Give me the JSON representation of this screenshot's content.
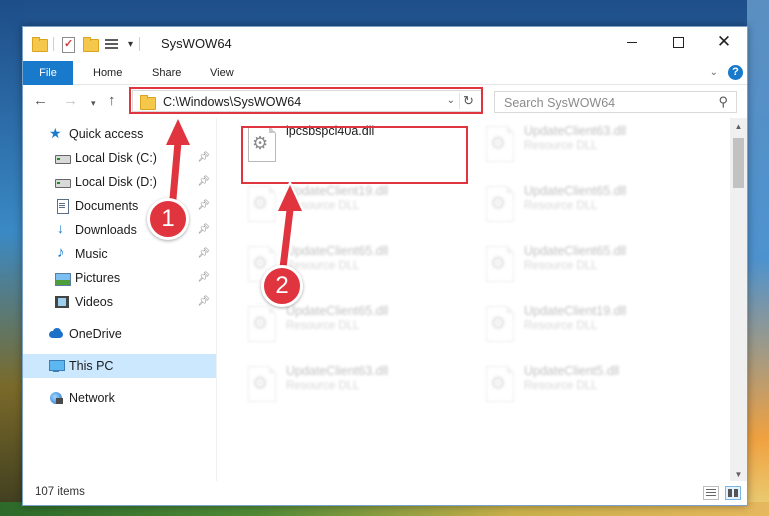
{
  "window": {
    "title": "SysWOW64",
    "controls": {
      "minimize": "",
      "maximize": "",
      "close": "✕"
    }
  },
  "ribbon": {
    "tabs": [
      "File",
      "Home",
      "Share",
      "View"
    ],
    "help": "?"
  },
  "address": {
    "path": "C:\\Windows\\SysWOW64",
    "refresh_icon": "↻",
    "dropdown_icon": "⌄"
  },
  "search": {
    "placeholder": "Search SysWOW64"
  },
  "sidebar": {
    "items": [
      {
        "label": "Quick access",
        "icon": "star-icon",
        "pinned": false
      },
      {
        "label": "Local Disk (C:)",
        "icon": "drive-icon",
        "pinned": true
      },
      {
        "label": "Local Disk (D:)",
        "icon": "drive-icon",
        "pinned": true
      },
      {
        "label": "Documents",
        "icon": "documents-icon",
        "pinned": true
      },
      {
        "label": "Downloads",
        "icon": "downloads-icon",
        "pinned": true
      },
      {
        "label": "Music",
        "icon": "music-icon",
        "pinned": true
      },
      {
        "label": "Pictures",
        "icon": "pictures-icon",
        "pinned": true
      },
      {
        "label": "Videos",
        "icon": "videos-icon",
        "pinned": true
      },
      {
        "label": "OneDrive",
        "icon": "onedrive-icon",
        "pinned": false
      },
      {
        "label": "This PC",
        "icon": "this-pc-icon",
        "pinned": false,
        "selected": true
      },
      {
        "label": "Network",
        "icon": "network-icon",
        "pinned": false
      }
    ]
  },
  "files": [
    {
      "name": "ipcsbspci40a.dll",
      "type": "",
      "highlighted": true
    },
    {
      "name": "UpdateClient63.dll",
      "type": "Resource DLL"
    },
    {
      "name": "UpdateClient19.dll",
      "type": "Resource DLL"
    },
    {
      "name": "UpdateClient65.dll",
      "type": "Resource DLL"
    },
    {
      "name": "UpdateClient65.dll",
      "type": "Resource DLL"
    },
    {
      "name": "UpdateClient65.dll",
      "type": "Resource DLL"
    },
    {
      "name": "UpdateClient65.dll",
      "type": "Resource DLL"
    },
    {
      "name": "UpdateClient19.dll",
      "type": "Resource DLL"
    },
    {
      "name": "UpdateClient63.dll",
      "type": "Resource DLL"
    },
    {
      "name": "UpdateClient5.dll",
      "type": "Resource DLL"
    }
  ],
  "status": {
    "item_count": "107 items"
  },
  "callouts": {
    "one": "1",
    "two": "2"
  },
  "colors": {
    "accent": "#1979ca",
    "highlight": "#e0343e",
    "selected": "#cce8ff"
  }
}
